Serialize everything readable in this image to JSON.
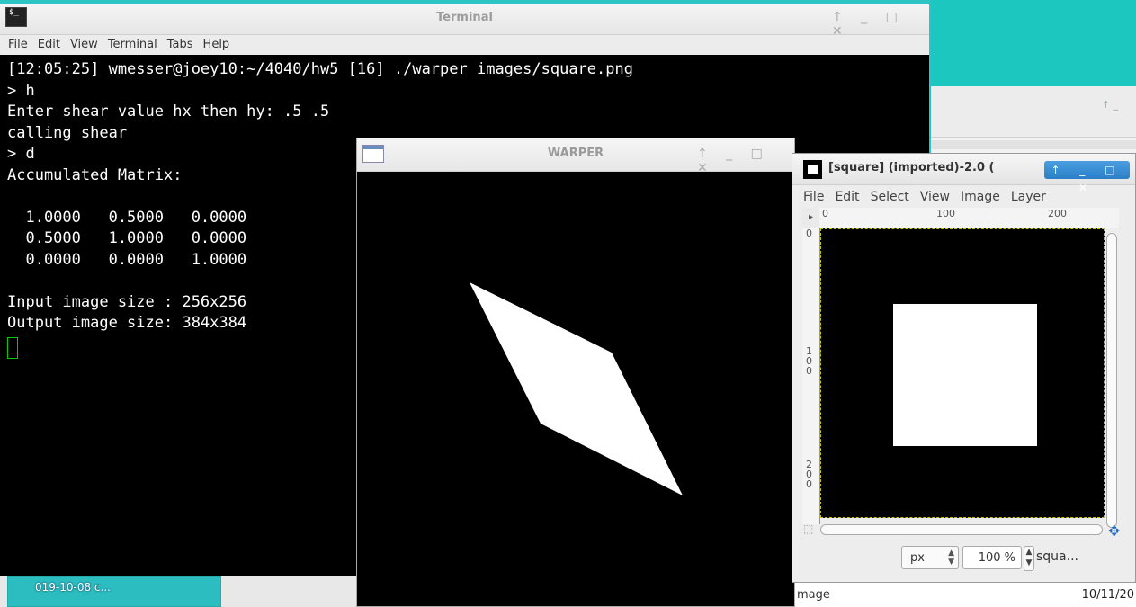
{
  "terminal": {
    "title": "Terminal",
    "menu": [
      "File",
      "Edit",
      "View",
      "Terminal",
      "Tabs",
      "Help"
    ],
    "lines": [
      "[12:05:25] wmesser@joey10:~/4040/hw5 [16] ./warper images/square.png",
      "> h",
      "Enter shear value hx then hy: .5 .5",
      "calling shear",
      "> d",
      "Accumulated Matrix:",
      "",
      "  1.0000   0.5000   0.0000",
      "  0.5000   1.0000   0.0000",
      "  0.0000   0.0000   1.0000",
      "",
      "Input image size : 256x256",
      "Output image size: 384x384"
    ],
    "icon": "terminal-icon"
  },
  "warper": {
    "title": "WARPER",
    "icon": "window-icon"
  },
  "gimp": {
    "title": "[square] (imported)-2.0 (",
    "menu": [
      "File",
      "Edit",
      "Select",
      "View",
      "Image",
      "Layer"
    ],
    "hruler_labels": [
      "0",
      "100",
      "200"
    ],
    "vruler_labels": [
      "0",
      "1\n0\n0",
      "2\n0\n0"
    ],
    "unit": "px",
    "zoom": "100 %",
    "status": "squa...",
    "window_buttons": "↑ _ □ ✕"
  },
  "taskbar": {
    "task_label": "019-10-08 c...",
    "status_left": "mage",
    "clock": "10/11/20"
  },
  "window_buttons": "↑ _ □ ✕"
}
